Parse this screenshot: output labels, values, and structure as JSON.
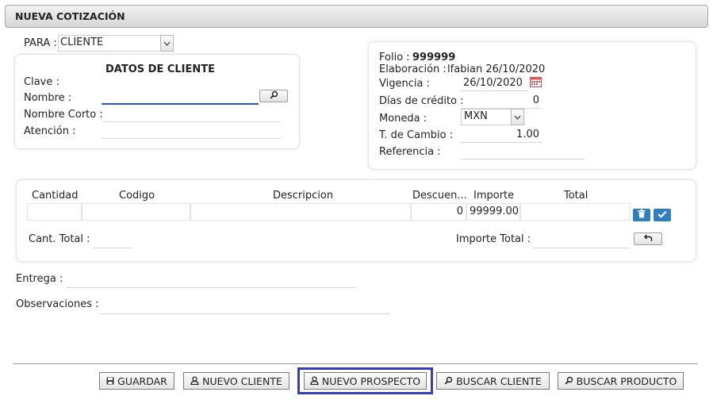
{
  "header": {
    "title": "NUEVA COTIZACIÓN"
  },
  "para": {
    "label": "PARA :",
    "value": "CLIENTE"
  },
  "cliente": {
    "title": "DATOS DE CLIENTE",
    "clave_label": "Clave :",
    "nombre_label": "Nombre :",
    "nombre_corto_label": "Nombre Corto :",
    "atencion_label": "Atención :"
  },
  "info": {
    "folio_label": "Folio :",
    "folio_value": "999999",
    "elaboracion_label": "Elaboración :",
    "elaboracion_value": "lfabian 26/10/2020",
    "vigencia_label": "Vigencia :",
    "vigencia_value": "26/10/2020",
    "dias_credito_label": "Días de crédito :",
    "dias_credito_value": "0",
    "moneda_label": "Moneda :",
    "moneda_value": "MXN",
    "tipo_cambio_label": "T. de Cambio :",
    "tipo_cambio_value": "1.00",
    "referencia_label": "Referencia :"
  },
  "table": {
    "headers": [
      "Cantidad",
      "Codigo",
      "Descripcion",
      "Descuen...",
      "Importe",
      "Total"
    ],
    "row": {
      "cantidad": "",
      "codigo": "",
      "descripcion": "",
      "descuento": "0",
      "importe": "99999.00",
      "total": ""
    },
    "cant_total_label": "Cant. Total :",
    "importe_total_label": "Importe Total :"
  },
  "entrega_label": "Entrega :",
  "observaciones_label": "Observaciones :",
  "actions": {
    "guardar": "GUARDAR",
    "nuevo_cliente": "NUEVO CLIENTE",
    "nuevo_prospecto": "NUEVO PROSPECTO",
    "buscar_cliente": "BUSCAR CLIENTE",
    "buscar_producto": "BUSCAR PRODUCTO"
  },
  "colors": {
    "highlight": "#3a3dbb",
    "accent_blue": "#2f7fc0",
    "focus_underline": "#2a55a8"
  }
}
